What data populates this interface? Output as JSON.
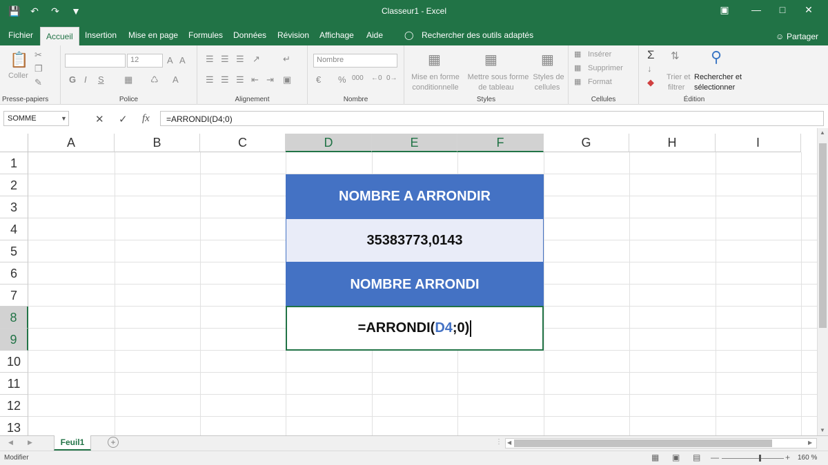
{
  "window": {
    "title": "Classeur1 - Excel"
  },
  "quick_access": {
    "save_icon": "save-icon",
    "undo_icon": "undo-icon",
    "redo_icon": "redo-icon",
    "customize_icon": "customize-icon"
  },
  "tabs": [
    "Fichier",
    "Accueil",
    "Insertion",
    "Mise en page",
    "Formules",
    "Données",
    "Révision",
    "Affichage",
    "Aide"
  ],
  "active_tab": "Accueil",
  "tell_me": "Rechercher des outils adaptés",
  "share": "Partager",
  "ribbon": {
    "clipboard": {
      "paste": "Coller",
      "label": "Presse-papiers"
    },
    "font": {
      "font_size": "12",
      "bold": "G",
      "italic": "I",
      "underline": "S",
      "label": "Police"
    },
    "alignment": {
      "label": "Alignement"
    },
    "number": {
      "format": "Nombre",
      "label": "Nombre"
    },
    "styles": {
      "cond_format_1": "Mise en forme",
      "cond_format_2": "conditionnelle",
      "table_1": "Mettre sous forme",
      "table_2": "de tableau",
      "cell_styles_1": "Styles de",
      "cell_styles_2": "cellules",
      "label": "Styles"
    },
    "cells": {
      "insert": "Insérer",
      "delete": "Supprimer",
      "format": "Format",
      "label": "Cellules"
    },
    "editing": {
      "sort_1": "Trier et",
      "sort_2": "filtrer",
      "find_1": "Rechercher et",
      "find_2": "sélectionner",
      "label": "Édition"
    }
  },
  "formula_bar": {
    "name_box": "SOMME",
    "formula": "=ARRONDI(D4;0)"
  },
  "columns": [
    "A",
    "B",
    "C",
    "D",
    "E",
    "F",
    "G",
    "H",
    "I"
  ],
  "rows": [
    "1",
    "2",
    "3",
    "4",
    "5",
    "6",
    "7",
    "8",
    "9",
    "10",
    "11",
    "12",
    "13"
  ],
  "cells": {
    "header1": "NOMBRE A ARRONDIR",
    "value": "35383773,0143",
    "header2": "NOMBRE ARRONDI",
    "formula_prefix": "=ARRONDI(",
    "formula_ref": "D4",
    "formula_suffix": ";0)"
  },
  "sheets": [
    "Feuil1"
  ],
  "status": {
    "mode": "Modifier",
    "zoom": "160 %"
  },
  "colors": {
    "accent": "#217346",
    "header_fill": "#4472c4",
    "value_fill": "#e9ecf8"
  }
}
